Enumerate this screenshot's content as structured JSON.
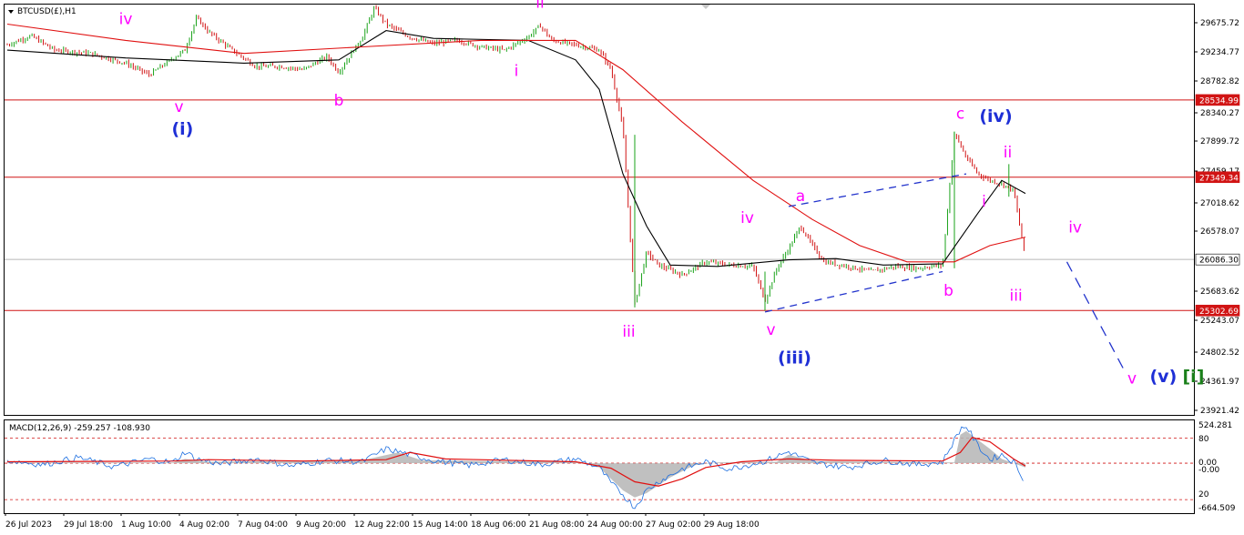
{
  "window": {
    "symbol_label": "BTCUSD(£),H1",
    "menu_icon": "triangle-down-icon"
  },
  "colors": {
    "candle_up": "#1aa31a",
    "candle_down": "#d11414",
    "ma_fast": "#000000",
    "ma_slow": "#e01010",
    "hline": "#d11414",
    "current_line": "#b8b8b8",
    "wave_minor": "#ff00ff",
    "wave_intermediate": "#1e2fd6",
    "wave_primary": "#1a7f1a",
    "projection": "#2233cc",
    "macd_line": "#1e6fe0",
    "macd_hist": "#b5b5b5",
    "macd_signal": "#e01010"
  },
  "chart_data": [
    {
      "type": "candlestick",
      "title": "BTCUSD(£),H1",
      "x_tick_labels": [
        "26 Jul 2023",
        "29 Jul 18:00",
        "1 Aug 10:00",
        "4 Aug 02:00",
        "7 Aug 04:00",
        "9 Aug 20:00",
        "12 Aug 22:00",
        "15 Aug 14:00",
        "18 Aug 06:00",
        "21 Aug 08:00",
        "24 Aug 00:00",
        "27 Aug 02:00",
        "29 Aug 18:00"
      ],
      "y_tick_labels": [
        "29675.72",
        "29234.77",
        "28782.82",
        "28340.27",
        "27899.72",
        "27459.17",
        "27018.62",
        "26578.07",
        "25683.62",
        "25243.07",
        "24802.52",
        "24361.97",
        "23921.42"
      ],
      "ylim": [
        23921.42,
        30000
      ],
      "price_path": [
        [
          0,
          29380
        ],
        [
          2,
          29520
        ],
        [
          4,
          29300
        ],
        [
          7,
          29250
        ],
        [
          9,
          29150
        ],
        [
          10,
          29100
        ],
        [
          12,
          28920
        ],
        [
          13,
          29050
        ],
        [
          15,
          29300
        ],
        [
          16,
          29800
        ],
        [
          17,
          29580
        ],
        [
          19,
          29300
        ],
        [
          21,
          29050
        ],
        [
          23,
          29050
        ],
        [
          25,
          29000
        ],
        [
          27,
          29200
        ],
        [
          28,
          28960
        ],
        [
          30,
          29500
        ],
        [
          31,
          29950
        ],
        [
          32,
          29700
        ],
        [
          34,
          29500
        ],
        [
          36,
          29400
        ],
        [
          38,
          29450
        ],
        [
          40,
          29350
        ],
        [
          42,
          29300
        ],
        [
          44,
          29500
        ],
        [
          45,
          29680
        ],
        [
          46,
          29450
        ],
        [
          48,
          29380
        ],
        [
          50,
          29300
        ],
        [
          51,
          29000
        ],
        [
          52,
          28100
        ],
        [
          53,
          25400
        ],
        [
          54,
          26200
        ],
        [
          55,
          26000
        ],
        [
          57,
          25850
        ],
        [
          59,
          26050
        ],
        [
          61,
          26000
        ],
        [
          63,
          25980
        ],
        [
          64,
          25450
        ],
        [
          65,
          25950
        ],
        [
          66,
          26250
        ],
        [
          67,
          26600
        ],
        [
          68,
          26300
        ],
        [
          69,
          26050
        ],
        [
          71,
          25980
        ],
        [
          73,
          25900
        ],
        [
          75,
          25980
        ],
        [
          77,
          25950
        ],
        [
          78,
          25980
        ],
        [
          79,
          26000
        ],
        [
          80,
          28030
        ],
        [
          81,
          27650
        ],
        [
          82,
          27400
        ],
        [
          83,
          27300
        ],
        [
          84,
          27250
        ],
        [
          85,
          27150
        ],
        [
          86,
          26100
        ]
      ],
      "moving_averages": [
        {
          "name": "",
          "color": "#000000",
          "points": [
            [
              0,
              29300
            ],
            [
              10,
              29180
            ],
            [
              20,
              29100
            ],
            [
              28,
              29150
            ],
            [
              32,
              29600
            ],
            [
              36,
              29480
            ],
            [
              44,
              29450
            ],
            [
              48,
              29150
            ],
            [
              50,
              28700
            ],
            [
              52,
              27400
            ],
            [
              54,
              26600
            ],
            [
              56,
              26000
            ],
            [
              60,
              25980
            ],
            [
              66,
              26080
            ],
            [
              70,
              26100
            ],
            [
              74,
              26000
            ],
            [
              79,
              26020
            ],
            [
              82,
              26800
            ],
            [
              84,
              27300
            ],
            [
              86,
              27100
            ]
          ]
        },
        {
          "name": "",
          "color": "#e01010",
          "points": [
            [
              0,
              29700
            ],
            [
              10,
              29450
            ],
            [
              20,
              29250
            ],
            [
              30,
              29350
            ],
            [
              40,
              29450
            ],
            [
              48,
              29450
            ],
            [
              52,
              29000
            ],
            [
              57,
              28200
            ],
            [
              63,
              27300
            ],
            [
              68,
              26700
            ],
            [
              72,
              26300
            ],
            [
              76,
              26050
            ],
            [
              80,
              26050
            ],
            [
              83,
              26300
            ],
            [
              86,
              26430
            ]
          ]
        }
      ],
      "horizontal_levels": [
        {
          "value": 28534.99,
          "label": "28534.99"
        },
        {
          "value": 27349.34,
          "label": "27349.34"
        },
        {
          "value": 25302.69,
          "label": "25302.69"
        }
      ],
      "current_price": {
        "value": 26086.3,
        "label": "26086.30"
      },
      "channel_lines": [
        {
          "from": [
            66,
            26900
          ],
          "to": [
            81,
            27400
          ]
        },
        {
          "from": [
            64,
            25280
          ],
          "to": [
            79,
            25900
          ]
        }
      ],
      "projection": {
        "points": [
          [
            89.5,
            26050
          ],
          [
            94.5,
            24330
          ]
        ]
      },
      "wave_labels": [
        {
          "text": "iv",
          "x": 10,
          "price": 29700,
          "class": "minor"
        },
        {
          "text": "v",
          "x": 14.5,
          "price": 28350,
          "class": "minor"
        },
        {
          "text": "(i)",
          "x": 14.8,
          "price": 28000,
          "class": "intermediate"
        },
        {
          "text": "b",
          "x": 28,
          "price": 28450,
          "class": "minor"
        },
        {
          "text": "ii",
          "x": 45,
          "price": 29950,
          "class": "minor"
        },
        {
          "text": "i",
          "x": 43,
          "price": 28900,
          "class": "minor"
        },
        {
          "text": "iii",
          "x": 52.5,
          "price": 24900,
          "class": "minor"
        },
        {
          "text": "iv",
          "x": 62.5,
          "price": 26650,
          "class": "minor"
        },
        {
          "text": "v",
          "x": 64.5,
          "price": 24930,
          "class": "minor"
        },
        {
          "text": "(iii)",
          "x": 66.5,
          "price": 24490,
          "class": "intermediate"
        },
        {
          "text": "a",
          "x": 67,
          "price": 26980,
          "class": "minor"
        },
        {
          "text": "b",
          "x": 79.5,
          "price": 25530,
          "class": "minor"
        },
        {
          "text": "c",
          "x": 80.5,
          "price": 28250,
          "class": "minor"
        },
        {
          "text": "(iv)",
          "x": 83.5,
          "price": 28200,
          "class": "intermediate"
        },
        {
          "text": "ii",
          "x": 84.5,
          "price": 27650,
          "class": "minor"
        },
        {
          "text": "i",
          "x": 82.5,
          "price": 26900,
          "class": "minor"
        },
        {
          "text": "iii",
          "x": 85.2,
          "price": 25450,
          "class": "minor"
        },
        {
          "text": "iv",
          "x": 90.2,
          "price": 26500,
          "class": "minor"
        },
        {
          "text": "v",
          "x": 95,
          "price": 24180,
          "class": "minor"
        }
      ],
      "wave_label_final": {
        "parts": [
          "(v)",
          "[i]"
        ],
        "x": 96.5,
        "price": 24200
      }
    },
    {
      "type": "line",
      "title": "MACD(12,26,9) -259.257 -108.930",
      "indicator": "MACD(12,26,9)",
      "values_shown": [
        "-259.257",
        "-108.930"
      ],
      "y_tick_labels": [
        "524.281",
        "80",
        "0.00",
        "-0.00",
        "20",
        "-664.509"
      ],
      "ylim": [
        -664.509,
        524.281
      ],
      "dotted_levels": [
        350,
        0,
        -510
      ],
      "histogram_path": [
        [
          0,
          10
        ],
        [
          14,
          10
        ],
        [
          15,
          60
        ],
        [
          17,
          20
        ],
        [
          30,
          40
        ],
        [
          33,
          150
        ],
        [
          35,
          40
        ],
        [
          48,
          20
        ],
        [
          50,
          -60
        ],
        [
          52,
          -380
        ],
        [
          53,
          -480
        ],
        [
          54,
          -420
        ],
        [
          56,
          -200
        ],
        [
          58,
          -30
        ],
        [
          60,
          10
        ],
        [
          65,
          20
        ],
        [
          66,
          120
        ],
        [
          68,
          30
        ],
        [
          80,
          10
        ],
        [
          80.5,
          400
        ],
        [
          81,
          450
        ],
        [
          83,
          200
        ],
        [
          84,
          60
        ],
        [
          86,
          -60
        ]
      ],
      "signal_path": [
        [
          0,
          20
        ],
        [
          14,
          30
        ],
        [
          17,
          50
        ],
        [
          25,
          30
        ],
        [
          32,
          50
        ],
        [
          34,
          150
        ],
        [
          37,
          60
        ],
        [
          48,
          20
        ],
        [
          51,
          -70
        ],
        [
          53,
          -260
        ],
        [
          55,
          -320
        ],
        [
          57,
          -220
        ],
        [
          59,
          -60
        ],
        [
          62,
          20
        ],
        [
          66,
          60
        ],
        [
          70,
          40
        ],
        [
          79,
          30
        ],
        [
          80.5,
          150
        ],
        [
          81.5,
          360
        ],
        [
          83,
          300
        ],
        [
          85,
          60
        ],
        [
          86,
          -40
        ]
      ],
      "macd_path": [
        [
          0,
          40
        ],
        [
          3,
          -20
        ],
        [
          6,
          80
        ],
        [
          9,
          -50
        ],
        [
          12,
          60
        ],
        [
          14,
          10
        ],
        [
          15,
          160
        ],
        [
          16,
          60
        ],
        [
          18,
          -10
        ],
        [
          21,
          60
        ],
        [
          24,
          -40
        ],
        [
          27,
          40
        ],
        [
          30,
          20
        ],
        [
          32,
          200
        ],
        [
          34,
          120
        ],
        [
          36,
          40
        ],
        [
          39,
          -30
        ],
        [
          42,
          50
        ],
        [
          45,
          -20
        ],
        [
          48,
          60
        ],
        [
          50,
          -60
        ],
        [
          51,
          -280
        ],
        [
          52,
          -440
        ],
        [
          53,
          -620
        ],
        [
          54,
          -380
        ],
        [
          55,
          -260
        ],
        [
          57,
          -80
        ],
        [
          59,
          20
        ],
        [
          61,
          -80
        ],
        [
          64,
          30
        ],
        [
          66,
          160
        ],
        [
          68,
          10
        ],
        [
          71,
          -60
        ],
        [
          74,
          40
        ],
        [
          77,
          -20
        ],
        [
          79,
          20
        ],
        [
          80.5,
          480
        ],
        [
          81,
          520
        ],
        [
          82,
          240
        ],
        [
          83,
          50
        ],
        [
          84,
          120
        ],
        [
          85,
          20
        ],
        [
          86,
          -260
        ]
      ]
    }
  ]
}
